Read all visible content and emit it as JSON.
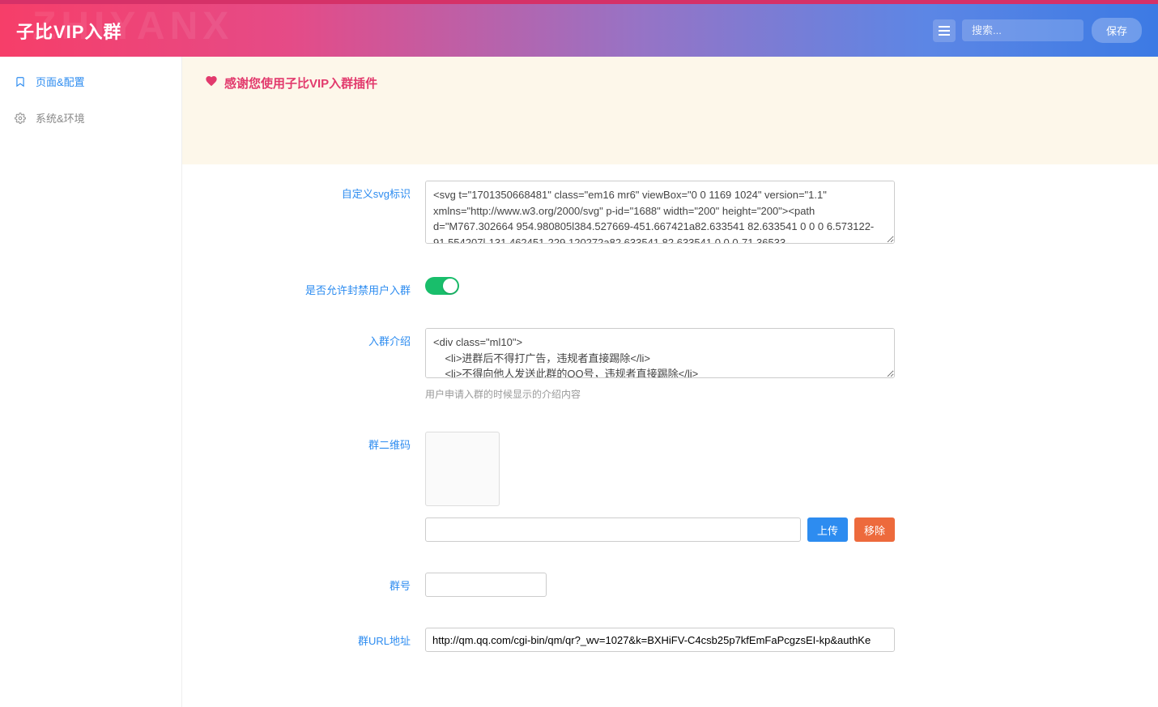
{
  "header": {
    "brand": "子比VIP入群",
    "watermark": "ZHIYANX",
    "search_placeholder": "搜索...",
    "save_label": "保存"
  },
  "sidebar": {
    "items": [
      {
        "icon": "bookmark",
        "label": "页面&配置"
      },
      {
        "icon": "gear",
        "label": "系统&环境"
      }
    ]
  },
  "banner": {
    "text": "感谢您使用子比VIP入群插件"
  },
  "form": {
    "svg_label": "自定义svg标识",
    "svg_value": "<svg t=\"1701350668481\" class=\"em16 mr6\" viewBox=\"0 0 1169 1024\" version=\"1.1\" xmlns=\"http://www.w3.org/2000/svg\" p-id=\"1688\" width=\"200\" height=\"200\"><path d=\"M767.302664 954.980805l384.527669-451.667421a82.633541 82.633541 0 0 0 6.573122-91.554207l-131.462451-229.120272a82.633541 82.633541 0 0 0-71.36533-",
    "allow_banned_label": "是否允许封禁用户入群",
    "allow_banned_on": true,
    "intro_label": "入群介绍",
    "intro_value": "<div class=\"ml10\">\n    <li>进群后不得打广告，违规者直接踢除</li>\n    <li>不得向他人发送此群的QQ号，违规者直接踢除</li>",
    "intro_hint": "用户申请入群的时候显示的介绍内容",
    "qr_label": "群二维码",
    "qr_path": "",
    "upload_label": "上传",
    "remove_label": "移除",
    "groupno_label": "群号",
    "groupno_value": "",
    "url_label": "群URL地址",
    "url_value": "http://qm.qq.com/cgi-bin/qm/qr?_wv=1027&k=BXHiFV-C4csb25p7kfEmFaPcgzsEI-kp&authKe"
  }
}
